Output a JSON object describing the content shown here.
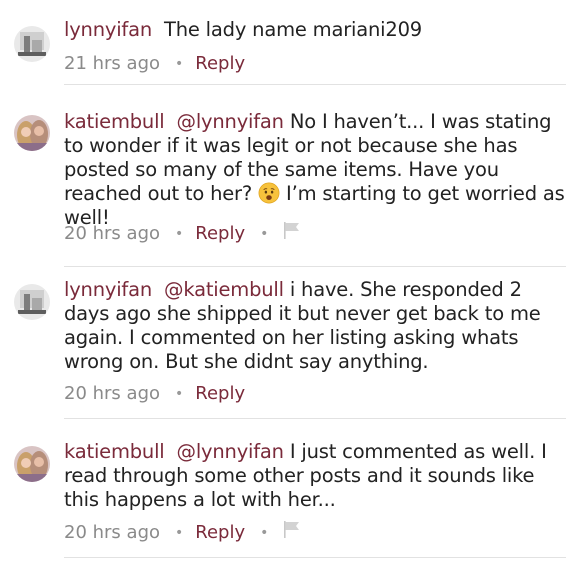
{
  "comments": [
    {
      "username": "lynnyifan",
      "mention": "",
      "text": "The lady name mariani209",
      "time": "21 hrs ago",
      "reply_label": "Reply",
      "has_flag": false,
      "avatar": "lynnyifan-avatar"
    },
    {
      "username": "katiembull",
      "mention": "@lynnyifan",
      "text_before_emoji": "No I haven’t... I was stating to wonder if it was legit or not because she has posted so many of the same items. Have you reached out to her?",
      "text_after_emoji": "I’m starting to get worried as well!",
      "emoji": "worried-face-emoji",
      "time": "20 hrs ago",
      "reply_label": "Reply",
      "has_flag": true,
      "avatar": "katiembull-avatar"
    },
    {
      "username": "lynnyifan",
      "mention": "@katiembull",
      "text": "i have. She responded 2 days ago she shipped it but never get back to me again. I commented on her listing asking whats wrong on. But she didnt say anything.",
      "time": "20 hrs ago",
      "reply_label": "Reply",
      "has_flag": false,
      "avatar": "lynnyifan-avatar"
    },
    {
      "username": "katiembull",
      "mention": "@lynnyifan",
      "text": "I just commented as well. I read through some other posts and it sounds like this happens a lot with her...",
      "time": "20 hrs ago",
      "reply_label": "Reply",
      "has_flag": true,
      "avatar": "katiembull-avatar"
    }
  ],
  "colors": {
    "username": "#7a2a3a",
    "meta": "#8a8a8a",
    "divider": "#e2e2e2"
  },
  "icons": {
    "flag": "flag-icon",
    "separator": "dot-separator"
  }
}
